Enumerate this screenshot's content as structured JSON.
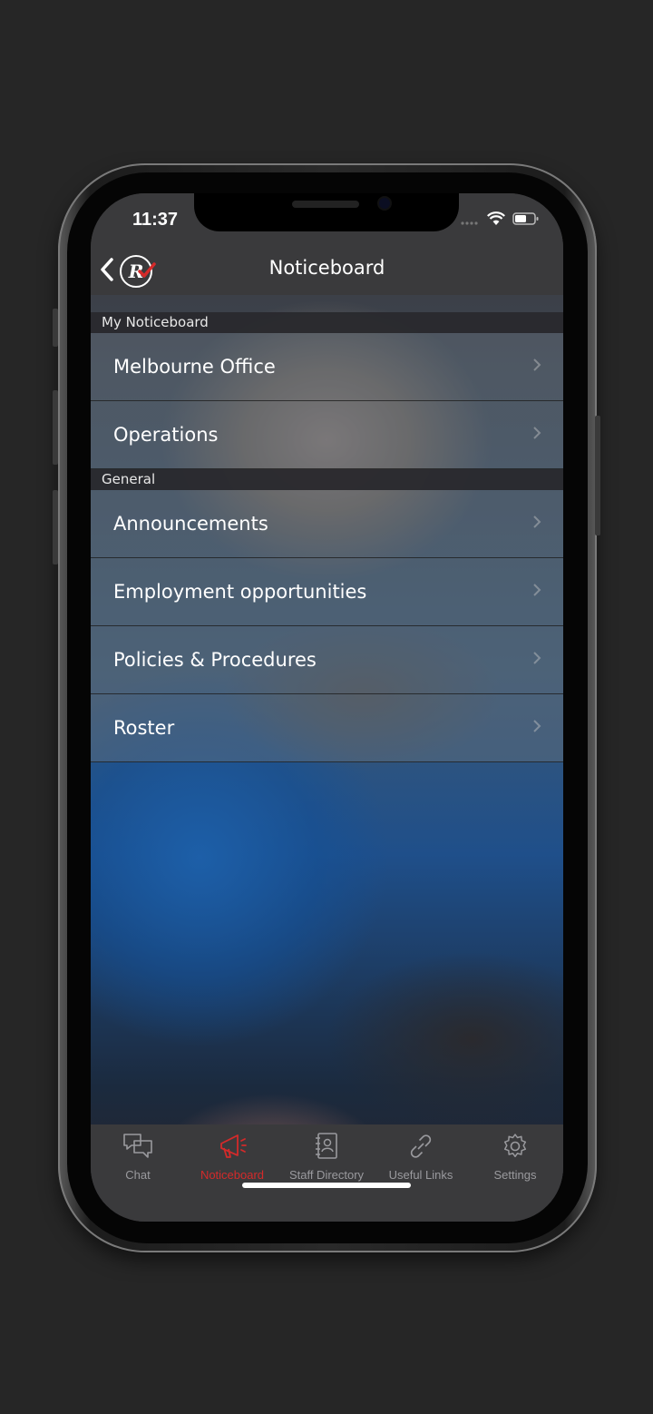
{
  "status": {
    "time": "11:37"
  },
  "nav": {
    "title": "Noticeboard"
  },
  "sections": [
    {
      "header": "My Noticeboard",
      "items": [
        "Melbourne Office",
        "Operations"
      ]
    },
    {
      "header": "General",
      "items": [
        "Announcements",
        "Employment opportunities",
        "Policies & Procedures",
        "Roster"
      ]
    }
  ],
  "tabs": [
    {
      "label": "Chat",
      "icon": "chat-icon"
    },
    {
      "label": "Noticeboard",
      "icon": "megaphone-icon",
      "active": true
    },
    {
      "label": "Staff Directory",
      "icon": "directory-icon"
    },
    {
      "label": "Useful Links",
      "icon": "link-icon"
    },
    {
      "label": "Settings",
      "icon": "gear-icon"
    }
  ],
  "colors": {
    "accent": "#d42a2a",
    "bar": "#3a3a3c",
    "tab_inactive": "#9a9a9e"
  }
}
